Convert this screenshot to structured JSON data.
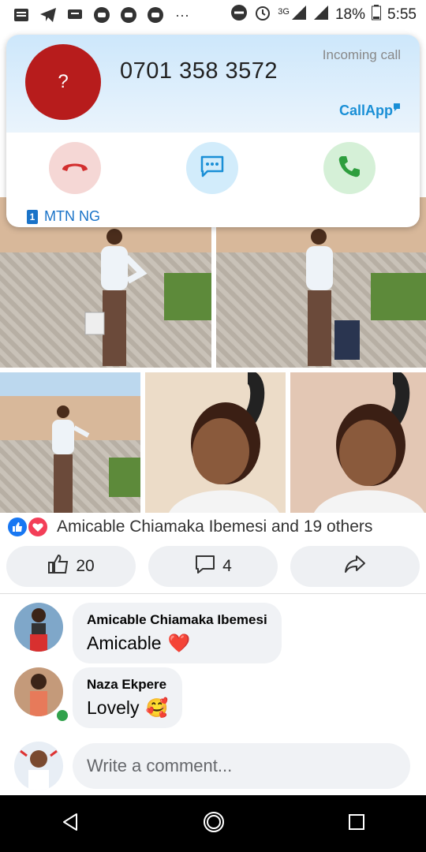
{
  "status_bar": {
    "net": "3G",
    "battery": "18%",
    "time": "5:55"
  },
  "incoming_call": {
    "avatar_text": "?",
    "number": "0701 358 3572",
    "status": "Incoming call",
    "brand": "CallApp",
    "sim_slot": "1",
    "carrier": "MTN NG",
    "colors": {
      "decline": "#f5d7d5",
      "message": "#d2ecfb",
      "accept": "#d5f0d7"
    }
  },
  "post": {
    "reactions_text": "Amicable Chiamaka Ibemesi and 19 others",
    "like_count": "20",
    "comment_count": "4"
  },
  "comments": [
    {
      "name": "Amicable Chiamaka Ibemesi",
      "text": "Amicable",
      "emoji": "❤️"
    },
    {
      "name": "Naza Ekpere",
      "text": "Lovely",
      "emoji": "🥰"
    }
  ],
  "composer": {
    "placeholder": "Write a comment..."
  }
}
